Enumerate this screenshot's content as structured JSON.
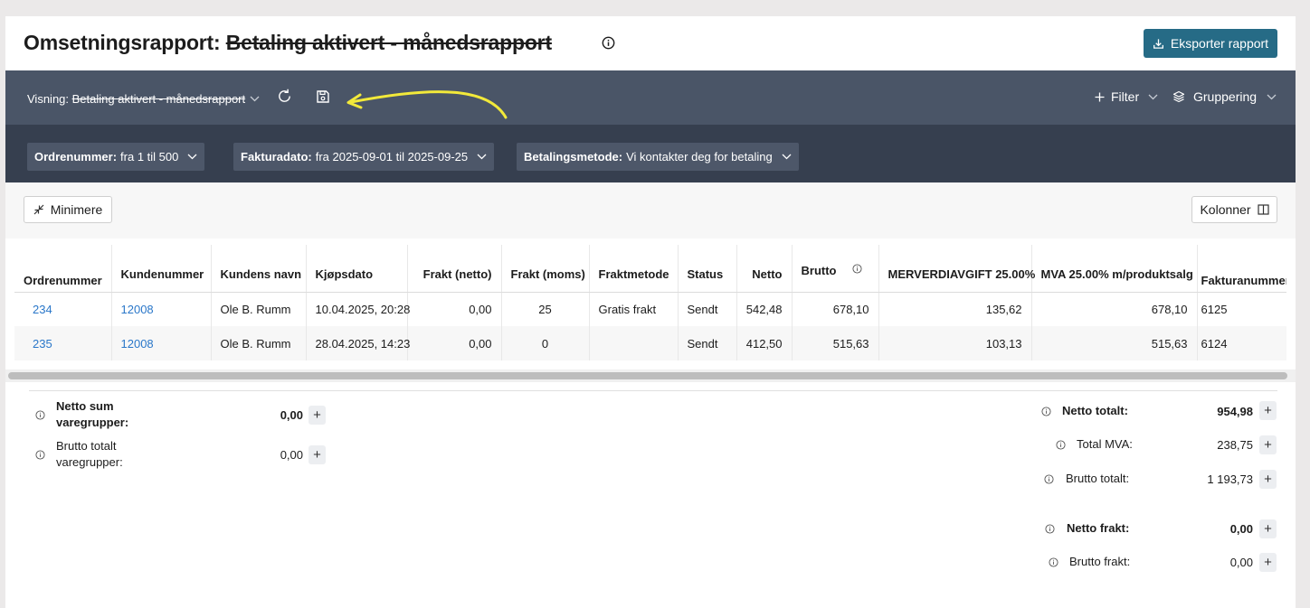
{
  "header": {
    "title_prefix": "Omsetningsrapport:",
    "title_struck": "Betaling aktivert - månedsrapport",
    "export_label": "Eksporter rapport"
  },
  "viewbar": {
    "view_prefix": "Visning:",
    "view_name": "Betaling aktivert - månedsrapport",
    "filter_label": "Filter",
    "grouping_label": "Gruppering",
    "annotation_color": "#f2e93a"
  },
  "filters": [
    {
      "key": "Ordrenummer:",
      "value": "fra 1 til 500"
    },
    {
      "key": "Fakturadato:",
      "value": "fra 2025-09-01 til 2025-09-25"
    },
    {
      "key": "Betalingsmetode:",
      "value": "Vi kontakter deg for betaling"
    }
  ],
  "toolbar": {
    "minimize_label": "Minimere",
    "columns_label": "Kolonner"
  },
  "table": {
    "columns": [
      "Ordrenummer",
      "Kundenummer",
      "Kundens navn",
      "Kjøpsdato",
      "Frakt (netto)",
      "Frakt (moms)",
      "Fraktmetode",
      "Status",
      "Netto",
      "Brutto",
      "MERVERDIAVGIFT 25.00%",
      "MVA 25.00% m/produktsalg",
      "Fakturanummer"
    ],
    "rows": [
      [
        "234",
        "12008",
        "Ole B. Rumm",
        "10.04.2025, 20:28",
        "0,00",
        "25",
        "Gratis frakt",
        "Sendt",
        "542,48",
        "678,10",
        "135,62",
        "678,10",
        "6125"
      ],
      [
        "235",
        "12008",
        "Ole B. Rumm",
        "28.04.2025, 14:23",
        "0,00",
        "0",
        "",
        "Sendt",
        "412,50",
        "515,63",
        "103,13",
        "515,63",
        "6124"
      ]
    ]
  },
  "left_summary": {
    "netto_label": "Netto sum varegrupper:",
    "netto_value": "0,00",
    "brutto_label": "Brutto totalt varegrupper:",
    "brutto_value": "0,00"
  },
  "right_summary": {
    "netto_total_label": "Netto totalt:",
    "netto_total_value": "954,98",
    "mva_label": "Total MVA:",
    "mva_value": "238,75",
    "brutto_total_label": "Brutto totalt:",
    "brutto_total_value": "1 193,73",
    "netto_frakt_label": "Netto frakt:",
    "netto_frakt_value": "0,00",
    "brutto_frakt_label": "Brutto frakt:",
    "brutto_frakt_value": "0,00"
  },
  "colors": {
    "accent": "#266b86",
    "viewbar_bg": "#4a5567",
    "filterbar_bg": "#363f4f",
    "link": "#2a77c9"
  }
}
